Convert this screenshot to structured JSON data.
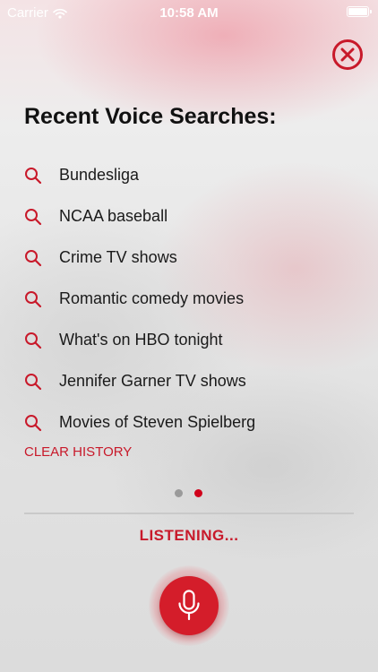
{
  "status_bar": {
    "carrier": "Carrier",
    "time": "10:58 AM"
  },
  "title": "Recent Voice Searches:",
  "recent_searches": [
    {
      "label": "Bundesliga",
      "icon": "search-icon"
    },
    {
      "label": "NCAA baseball",
      "icon": "search-icon"
    },
    {
      "label": "Crime TV shows",
      "icon": "search-icon"
    },
    {
      "label": "Romantic comedy movies",
      "icon": "search-icon"
    },
    {
      "label": "What's on HBO tonight",
      "icon": "search-icon"
    },
    {
      "label": "Jennifer Garner TV shows",
      "icon": "search-icon"
    },
    {
      "label": "Movies of Steven Spielberg",
      "icon": "search-icon"
    }
  ],
  "clear_history_label": "CLEAR HISTORY",
  "pagination": {
    "total_pages": 2,
    "current_page": 2
  },
  "listening_label": "LISTENING...",
  "icons": {
    "close": "close-icon",
    "search": "search-icon",
    "microphone": "microphone-icon",
    "wifi": "wifi-icon",
    "battery": "battery-icon"
  },
  "colors": {
    "accent": "#c8192a",
    "mic_button": "#d41d2a",
    "active_dot": "#d0021b",
    "inactive_dot": "#9a9a9a",
    "text": "#111111"
  }
}
